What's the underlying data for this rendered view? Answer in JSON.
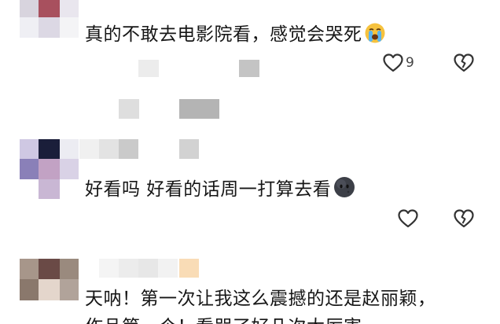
{
  "comments": [
    {
      "text": "真的不敢去电影院看，感觉会哭死",
      "emoji": "loudly-crying-face",
      "like_count": "9"
    },
    {
      "text": "好看吗 好看的话周一打算去看",
      "emoji": "new-moon-face",
      "like_count": ""
    },
    {
      "text": "天呐！第一次让我这么震撼的还是赵丽颖，",
      "text_line2": "作品第一个！看哭了好几次太厉害",
      "like_count": ""
    }
  ],
  "colors": {
    "icon": "#333333",
    "text": "#161616",
    "pixelated_gray": "#bdbdbd"
  }
}
